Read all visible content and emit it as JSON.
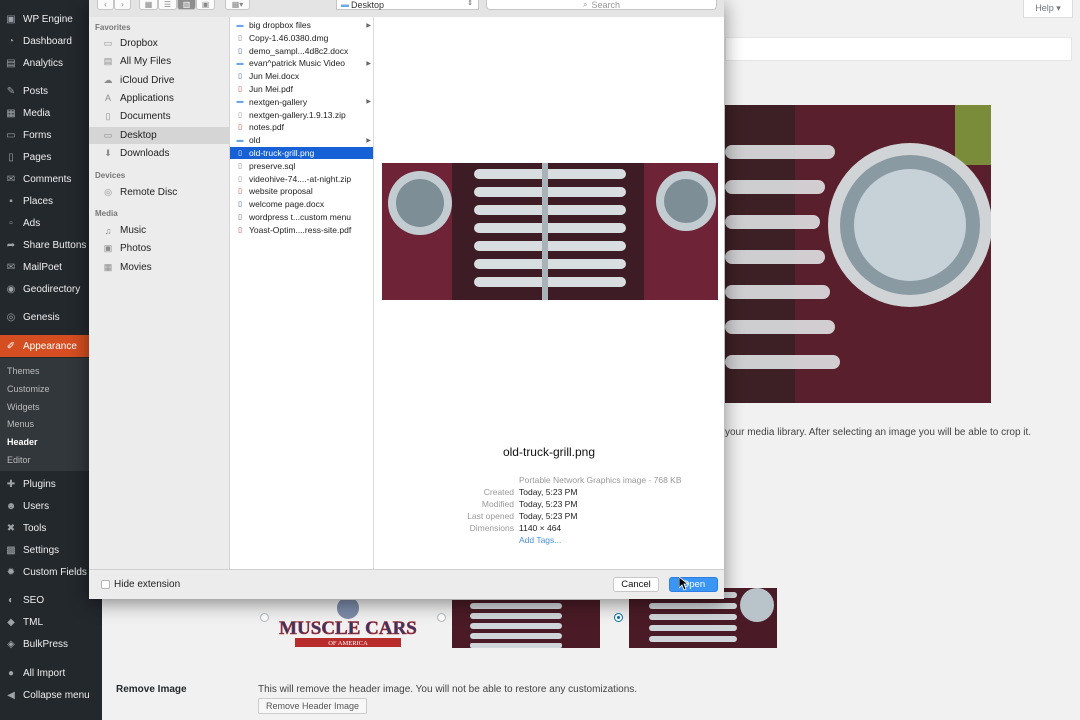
{
  "wp": {
    "menu": [
      {
        "label": "WP Engine",
        "icon": "wp-engine-icon",
        "glyph": "▣"
      },
      {
        "label": "Dashboard",
        "icon": "dashboard-icon",
        "glyph": "◔"
      },
      {
        "label": "Analytics",
        "icon": "analytics-icon",
        "glyph": "▤"
      },
      {
        "label": "Posts",
        "icon": "pin-icon",
        "glyph": "✎"
      },
      {
        "label": "Media",
        "icon": "media-icon",
        "glyph": "▦"
      },
      {
        "label": "Forms",
        "icon": "forms-icon",
        "glyph": "▭"
      },
      {
        "label": "Pages",
        "icon": "pages-icon",
        "glyph": "▯"
      },
      {
        "label": "Comments",
        "icon": "comments-icon",
        "glyph": "✉"
      },
      {
        "label": "Places",
        "icon": "places-icon",
        "glyph": "▪"
      },
      {
        "label": "Ads",
        "icon": "ads-icon",
        "glyph": "▫"
      },
      {
        "label": "Share Buttons",
        "icon": "share-icon",
        "glyph": "➦"
      },
      {
        "label": "MailPoet",
        "icon": "mail-icon",
        "glyph": "✉"
      },
      {
        "label": "Geodirectory",
        "icon": "globe-icon",
        "glyph": "◉"
      },
      {
        "label": "Genesis",
        "icon": "genesis-icon",
        "glyph": "◎"
      },
      {
        "label": "Appearance",
        "icon": "brush-icon",
        "glyph": "✐"
      },
      {
        "label": "Plugins",
        "icon": "plugin-icon",
        "glyph": "✚"
      },
      {
        "label": "Users",
        "icon": "users-icon",
        "glyph": "☻"
      },
      {
        "label": "Tools",
        "icon": "tools-icon",
        "glyph": "✖"
      },
      {
        "label": "Settings",
        "icon": "settings-icon",
        "glyph": "▩"
      },
      {
        "label": "Custom Fields",
        "icon": "gear-icon",
        "glyph": "✹"
      },
      {
        "label": "SEO",
        "icon": "seo-icon",
        "glyph": "◐"
      },
      {
        "label": "TML",
        "icon": "tml-icon",
        "glyph": "◆"
      },
      {
        "label": "BulkPress",
        "icon": "bulkpress-icon",
        "glyph": "◈"
      },
      {
        "label": "All Import",
        "icon": "import-icon",
        "glyph": "●"
      },
      {
        "label": "Collapse menu",
        "icon": "collapse-icon",
        "glyph": "◀"
      }
    ],
    "submenu": [
      "Themes",
      "Customize",
      "Widgets",
      "Menus",
      "Header",
      "Editor"
    ],
    "help": "Help ▾",
    "help_text": "your media library. After selecting an image you will be able to crop it.",
    "remove_label": "Remove Image",
    "remove_desc": "This will remove the header image. You will not be able to restore any customizations.",
    "remove_button": "Remove Header Image",
    "logo_text": "MUSCLE CARS",
    "logo_sub": "OF AMERICA"
  },
  "dialog": {
    "location": "Desktop",
    "search_placeholder": "Search",
    "sidebar": {
      "favorites_head": "Favorites",
      "favorites": [
        {
          "label": "Dropbox",
          "icon": "dropbox-icon",
          "glyph": "▭"
        },
        {
          "label": "All My Files",
          "icon": "all-files-icon",
          "glyph": "▤"
        },
        {
          "label": "iCloud Drive",
          "icon": "cloud-icon",
          "glyph": "☁"
        },
        {
          "label": "Applications",
          "icon": "applications-icon",
          "glyph": "A"
        },
        {
          "label": "Documents",
          "icon": "documents-icon",
          "glyph": "▯"
        },
        {
          "label": "Desktop",
          "icon": "desktop-icon",
          "glyph": "▭"
        },
        {
          "label": "Downloads",
          "icon": "downloads-icon",
          "glyph": "⬇"
        }
      ],
      "devices_head": "Devices",
      "devices": [
        {
          "label": "Remote Disc",
          "icon": "disc-icon",
          "glyph": "◎"
        }
      ],
      "media_head": "Media",
      "media": [
        {
          "label": "Music",
          "icon": "music-icon",
          "glyph": "♫"
        },
        {
          "label": "Photos",
          "icon": "camera-icon",
          "glyph": "▣"
        },
        {
          "label": "Movies",
          "icon": "movies-icon",
          "glyph": "▦"
        }
      ]
    },
    "files": [
      {
        "name": "big dropbox files",
        "icon": "folder-icon",
        "folder": true
      },
      {
        "name": "Copy-1.46.0380.dmg",
        "icon": "dmg-icon",
        "folder": false
      },
      {
        "name": "demo_sampl...4d8c2.docx",
        "icon": "docx-icon",
        "folder": false
      },
      {
        "name": "evan^patrick Music Video",
        "icon": "folder-icon",
        "folder": true
      },
      {
        "name": "Jun Mei.docx",
        "icon": "docx-icon",
        "folder": false
      },
      {
        "name": "Jun Mei.pdf",
        "icon": "pdf-icon",
        "folder": false
      },
      {
        "name": "nextgen-gallery",
        "icon": "folder-icon",
        "folder": true
      },
      {
        "name": "nextgen-gallery.1.9.13.zip",
        "icon": "zip-icon",
        "folder": false
      },
      {
        "name": "notes.pdf",
        "icon": "pdf-icon",
        "folder": false
      },
      {
        "name": "old",
        "icon": "folder-icon",
        "folder": true
      },
      {
        "name": "old-truck-grill.png",
        "icon": "image-icon",
        "folder": false,
        "selected": true
      },
      {
        "name": "preserve.sql",
        "icon": "sql-icon",
        "folder": false
      },
      {
        "name": "videohive-74....-at-night.zip",
        "icon": "zip-icon",
        "folder": false
      },
      {
        "name": "website proposal",
        "icon": "pdf-icon",
        "folder": false
      },
      {
        "name": "welcome page.docx",
        "icon": "docx-icon",
        "folder": false
      },
      {
        "name": "wordpress t...custom menu",
        "icon": "file-icon",
        "folder": false
      },
      {
        "name": "Yoast-Optim....ress-site.pdf",
        "icon": "pdf-icon",
        "folder": false
      }
    ],
    "preview": {
      "filename": "old-truck-grill.png",
      "kind": "Portable Network Graphics image - 768 KB",
      "meta": [
        {
          "label": "Created",
          "value": "Today, 5:23 PM"
        },
        {
          "label": "Modified",
          "value": "Today, 5:23 PM"
        },
        {
          "label": "Last opened",
          "value": "Today, 5:23 PM"
        },
        {
          "label": "Dimensions",
          "value": "1140 × 464"
        }
      ],
      "add_tags": "Add Tags..."
    },
    "hide_extension": "Hide extension",
    "cancel": "Cancel",
    "open": "Open"
  },
  "colors": {
    "wp_sidebar": "#23282d",
    "wp_active": "#d54e21",
    "selection": "#1661d6",
    "open_button": "#3b95f5"
  }
}
